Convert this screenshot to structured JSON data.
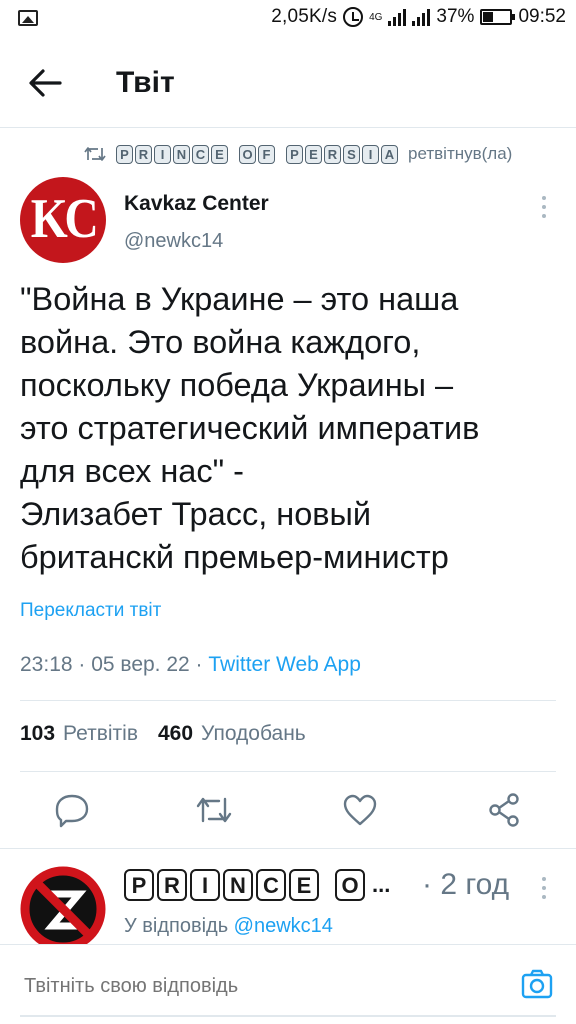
{
  "status_bar": {
    "speed": "2,05K/s",
    "network": "4G",
    "battery": "37%",
    "time": "09:52"
  },
  "header": {
    "title": "Твіт"
  },
  "retweet_line": {
    "retweeter_words": [
      [
        "P",
        "R",
        "I",
        "N",
        "C",
        "E"
      ],
      [
        "O",
        "F"
      ],
      [
        "P",
        "E",
        "R",
        "S",
        "I",
        "A"
      ]
    ],
    "suffix": "ретвітнув(ла)"
  },
  "tweet": {
    "author_name": "Kavkaz Center",
    "author_handle": "@newkc14",
    "avatar_text": "KC",
    "text": "\"Война в Украине – это наша\nвойна. Это война каждого,\nпоскольку победа Украины –\nэто стратегический императив\nдля всех нас\" -\nЭлизабет Трасс, новый\nбританскй премьер-министр",
    "translate_label": "Перекласти твіт",
    "timestamp": "23:18 · 05 вер. 22 · ",
    "source": "Twitter Web App",
    "retweets_count": "103",
    "retweets_label": "Ретвітів",
    "likes_count": "460",
    "likes_label": "Уподобань"
  },
  "reply": {
    "name_letters": [
      "P",
      "R",
      "I",
      "N",
      "C",
      "E",
      "O"
    ],
    "name_ellipsis": "...",
    "time": "· 2 год",
    "reply_prefix": "У відповідь ",
    "reply_mention": "@newkc14"
  },
  "composer": {
    "placeholder": "Твітніть свою відповідь"
  },
  "colors": {
    "accent": "#1da1f2",
    "secondary_text": "#657786",
    "avatar_red": "#c3161c"
  }
}
